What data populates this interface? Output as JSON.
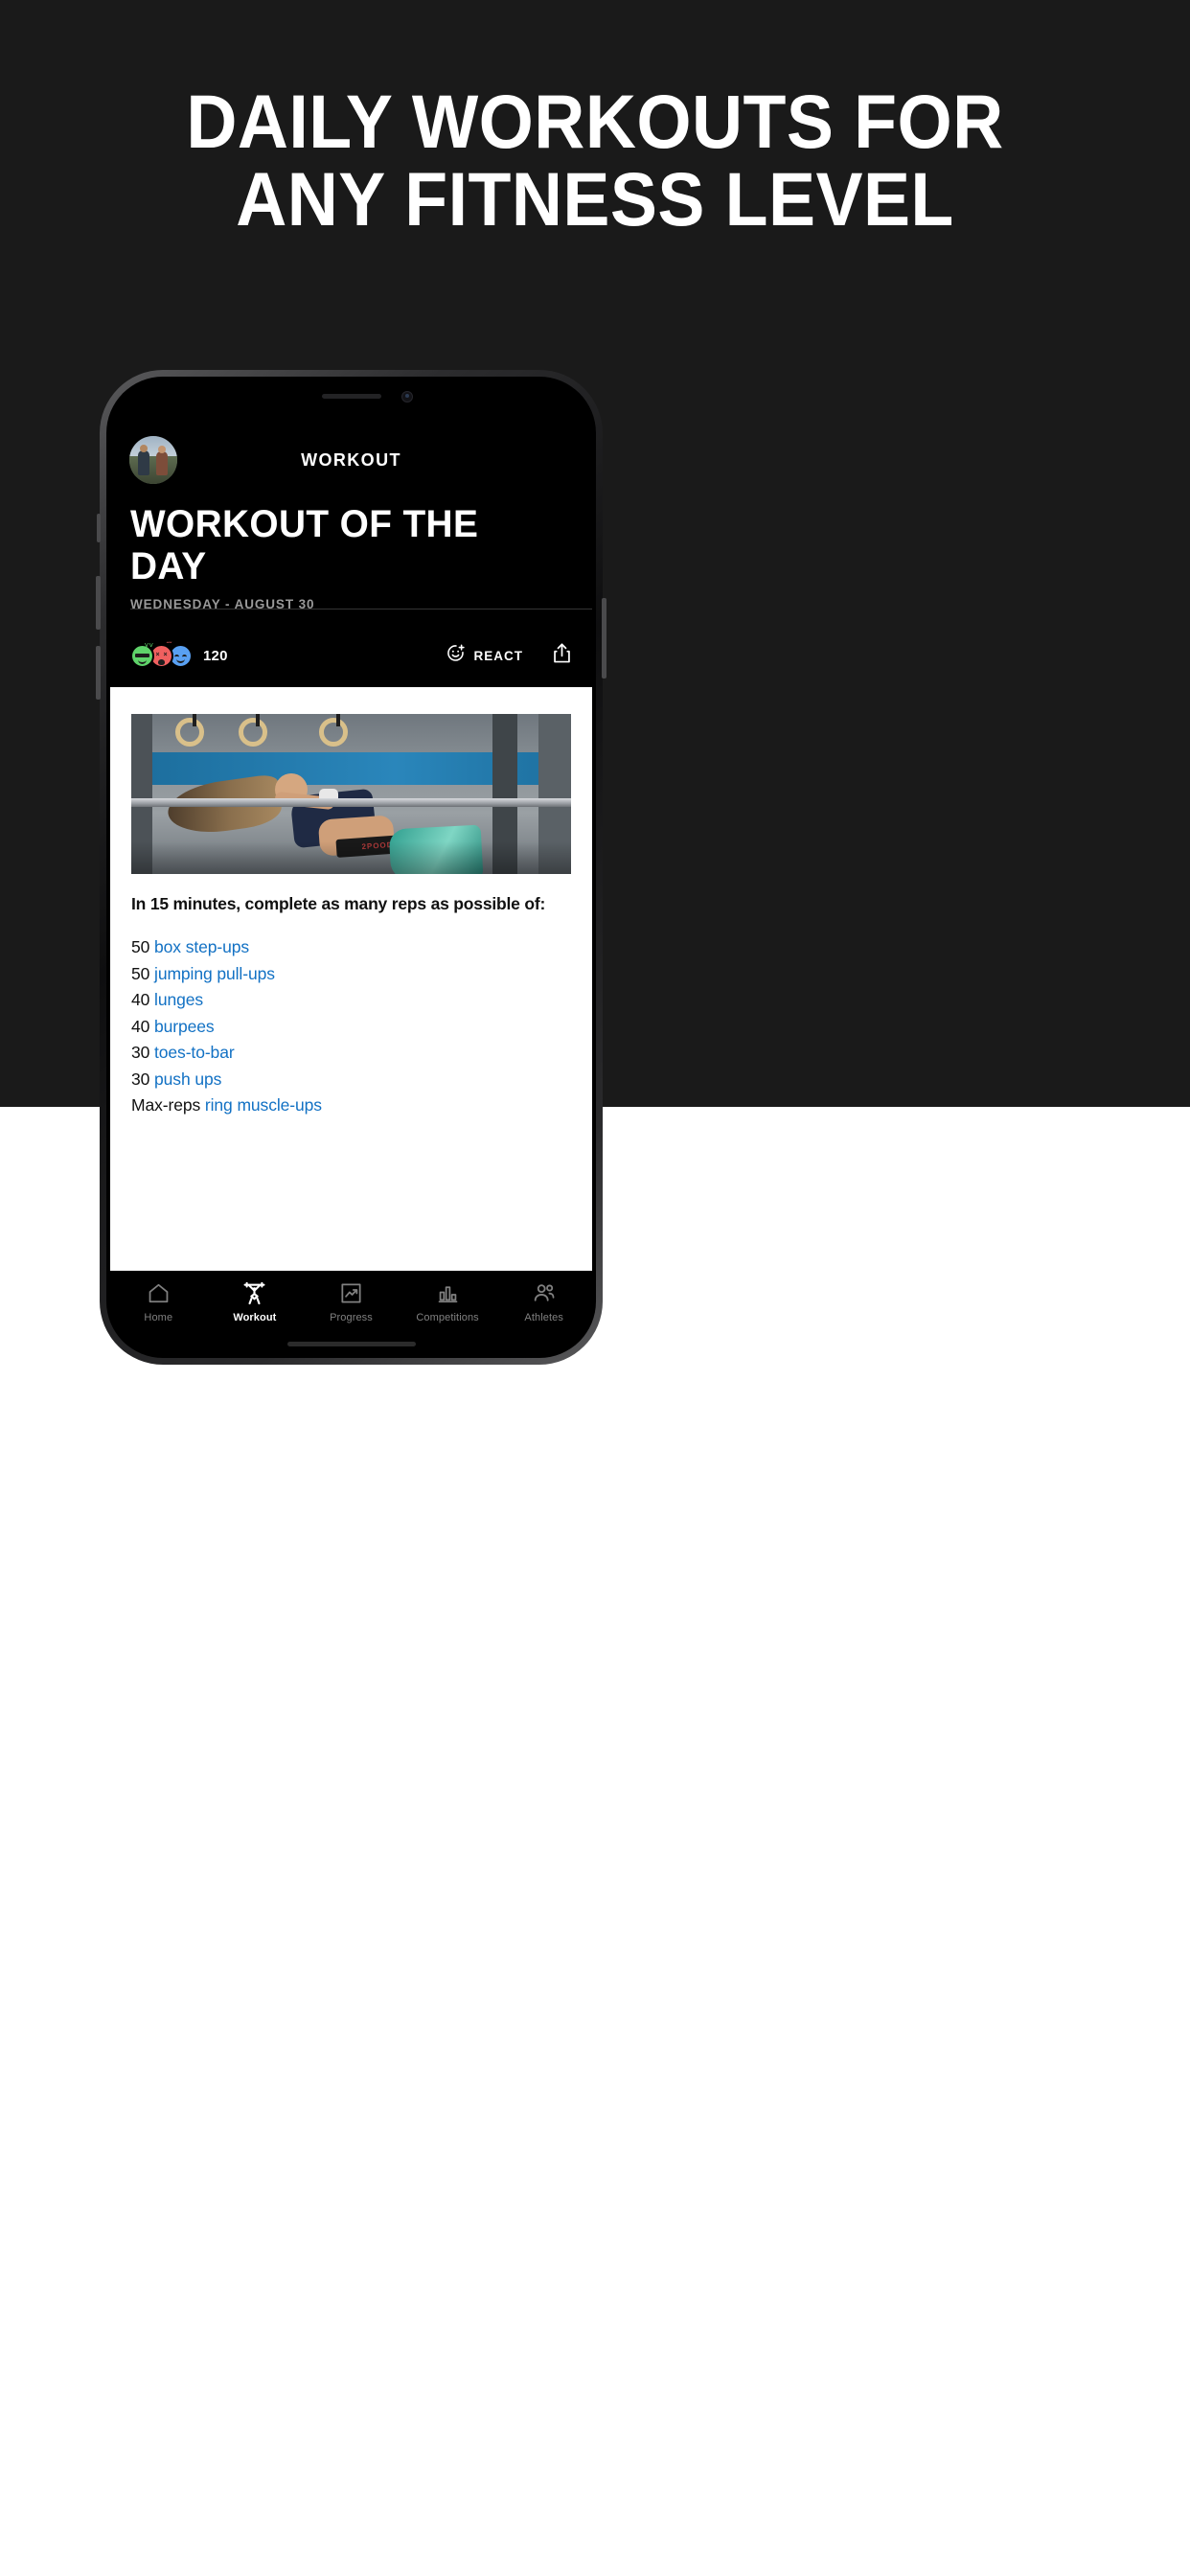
{
  "promo": {
    "headline_line1": "DAILY WORKOUTS FOR",
    "headline_line2": "ANY FITNESS LEVEL",
    "background_color": "#1a1a1a",
    "text_color": "#ffffff"
  },
  "app": {
    "header": {
      "title": "WORKOUT",
      "avatar_name": "user-avatar"
    },
    "page": {
      "title": "WORKOUT OF THE DAY",
      "date": "WEDNESDAY - AUGUST 30"
    },
    "reactions": {
      "count": "120",
      "emojis": [
        {
          "name": "cool-face-emoji",
          "color": "#5fd36a"
        },
        {
          "name": "dizzy-face-emoji",
          "color": "#f0605f"
        },
        {
          "name": "smiling-face-emoji",
          "color": "#59a0f2"
        }
      ],
      "react_label": "REACT",
      "react_icon": "smiley-plus-icon",
      "share_icon": "share-icon"
    },
    "workout": {
      "photo_alt": "athlete-pull-up-photo",
      "belt_text": "2POOD",
      "description": "In 15 minutes, complete as many reps as possible of:",
      "exercises": [
        {
          "reps": "50",
          "name": "box step-ups"
        },
        {
          "reps": "50",
          "name": "jumping pull-ups"
        },
        {
          "reps": "40",
          "name": "lunges"
        },
        {
          "reps": "40",
          "name": "burpees"
        },
        {
          "reps": "30",
          "name": "toes-to-bar"
        },
        {
          "reps": "30",
          "name": "push ups"
        },
        {
          "reps": "Max-reps",
          "name": "ring muscle-ups"
        }
      ],
      "link_color": "#1271c4"
    },
    "tabs": [
      {
        "label": "Home",
        "icon": "home-icon",
        "active": false
      },
      {
        "label": "Workout",
        "icon": "barbell-icon",
        "active": true
      },
      {
        "label": "Progress",
        "icon": "chart-up-icon",
        "active": false
      },
      {
        "label": "Competitions",
        "icon": "bar-chart-icon",
        "active": false
      },
      {
        "label": "Athletes",
        "icon": "people-icon",
        "active": false
      }
    ]
  }
}
